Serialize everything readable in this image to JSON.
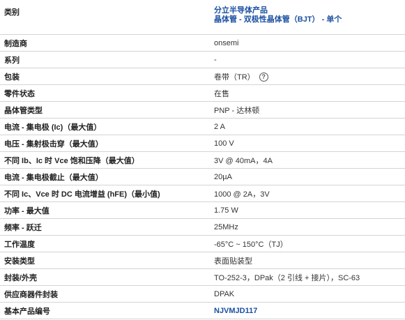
{
  "category": {
    "label": "类别",
    "link1": "分立半导体产品",
    "link2": "晶体管 - 双极性晶体管（BJT） - 单个"
  },
  "rows": [
    {
      "label": "制造商",
      "value": "onsemi"
    },
    {
      "label": "系列",
      "value": "-"
    },
    {
      "label": "包装",
      "value": "卷带（TR）"
    },
    {
      "label": "零件状态",
      "value": "在售"
    },
    {
      "label": "晶体管类型",
      "value": "PNP - 达林顿"
    },
    {
      "label": "电流 - 集电极 (Ic)（最大值）",
      "value": "2 A"
    },
    {
      "label": "电压 - 集射极击穿（最大值）",
      "value": "100 V"
    },
    {
      "label": "不同 Ib、Ic 时 Vce 饱和压降（最大值）",
      "value": "3V @ 40mA，4A"
    },
    {
      "label": "电流 - 集电极截止（最大值）",
      "value": "20µA"
    },
    {
      "label": "不同 Ic、Vce 时 DC 电流增益 (hFE)（最小值)",
      "value": "1000 @ 2A，3V"
    },
    {
      "label": "功率 - 最大值",
      "value": "1.75 W"
    },
    {
      "label": "频率 - 跃迁",
      "value": "25MHz"
    },
    {
      "label": "工作温度",
      "value": "-65°C ~ 150°C（TJ）"
    },
    {
      "label": "安装类型",
      "value": "表面贴装型"
    },
    {
      "label": "封装/外壳",
      "value": "TO-252-3，DPak（2 引线 + 接片），SC-63"
    },
    {
      "label": "供应商器件封装",
      "value": "DPAK"
    },
    {
      "label": "基本产品编号",
      "value": "NJVMJD117"
    }
  ],
  "help_icon": "?"
}
